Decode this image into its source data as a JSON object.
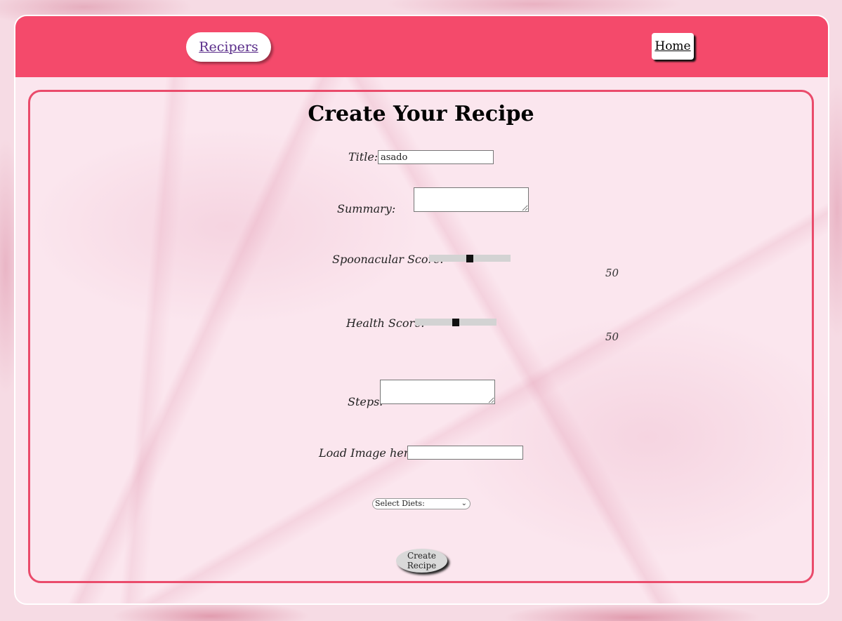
{
  "nav": {
    "brand": "Recipers",
    "home": "Home"
  },
  "form": {
    "heading": "Create Your Recipe",
    "title_label": "Title:",
    "title_value": "asado",
    "summary_label": "Summary:",
    "summary_value": "",
    "spoonacular_label": "Spoonacular Score:",
    "spoonacular_value": "50",
    "spoonacular_fraction": 0.5,
    "health_label": "Health Score:",
    "health_value": "50",
    "health_fraction": 0.5,
    "steps_label": "Steps:",
    "steps_value": "",
    "image_label": "Load Image here:",
    "image_value": "",
    "diets_selected": "Select Diets:",
    "submit_label": "Create Recipe"
  },
  "colors": {
    "accent": "#f44a6b",
    "panel_border": "#ea4b6b"
  }
}
